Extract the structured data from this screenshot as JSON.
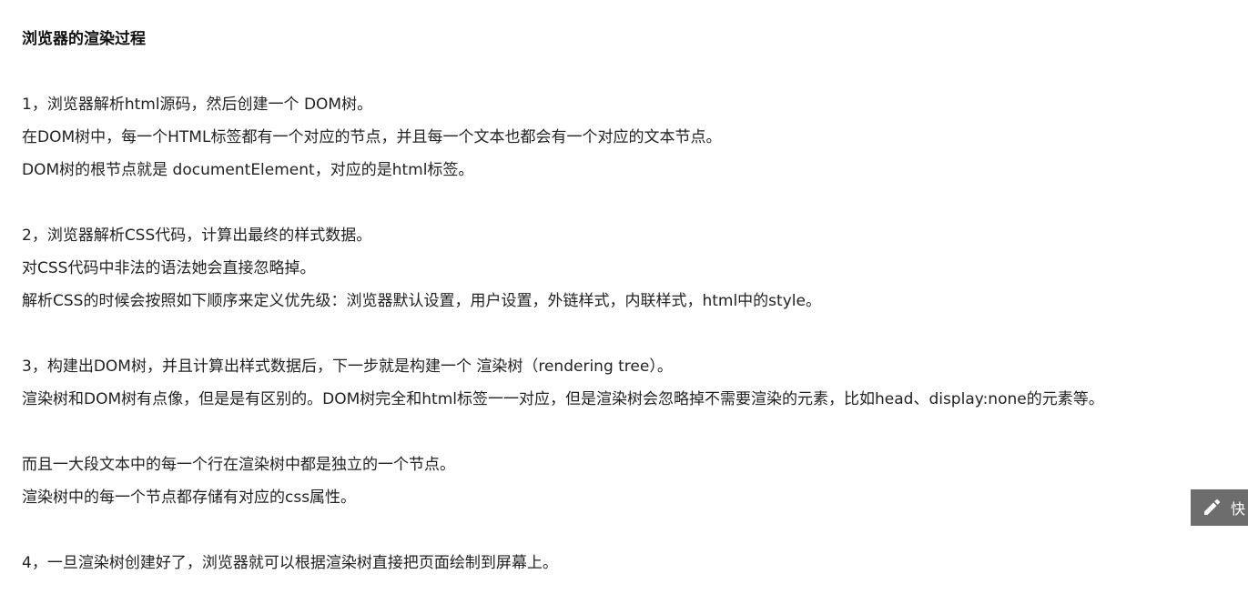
{
  "article": {
    "title": "浏览器的渲染过程",
    "lines": [
      "1，浏览器解析html源码，然后创建一个 DOM树。",
      "在DOM树中，每一个HTML标签都有一个对应的节点，并且每一个文本也都会有一个对应的文本节点。",
      "DOM树的根节点就是 documentElement，对应的是html标签。",
      "2，浏览器解析CSS代码，计算出最终的样式数据。",
      "对CSS代码中非法的语法她会直接忽略掉。",
      "解析CSS的时候会按照如下顺序来定义优先级：浏览器默认设置，用户设置，外链样式，内联样式，html中的style。",
      "3，构建出DOM树，并且计算出样式数据后，下一步就是构建一个 渲染树（rendering tree）。",
      "渲染树和DOM树有点像，但是是有区别的。DOM树完全和html标签一一对应，但是渲染树会忽略掉不需要渲染的元素，比如head、display:none的元素等。",
      "而且一大段文本中的每一个行在渲染树中都是独立的一个节点。",
      "渲染树中的每一个节点都存储有对应的css属性。",
      "4，一旦渲染树创建好了，浏览器就可以根据渲染树直接把页面绘制到屏幕上。"
    ]
  },
  "quick_button": {
    "label": "快",
    "icon": "pencil-icon",
    "background": "#6d6d6d"
  }
}
